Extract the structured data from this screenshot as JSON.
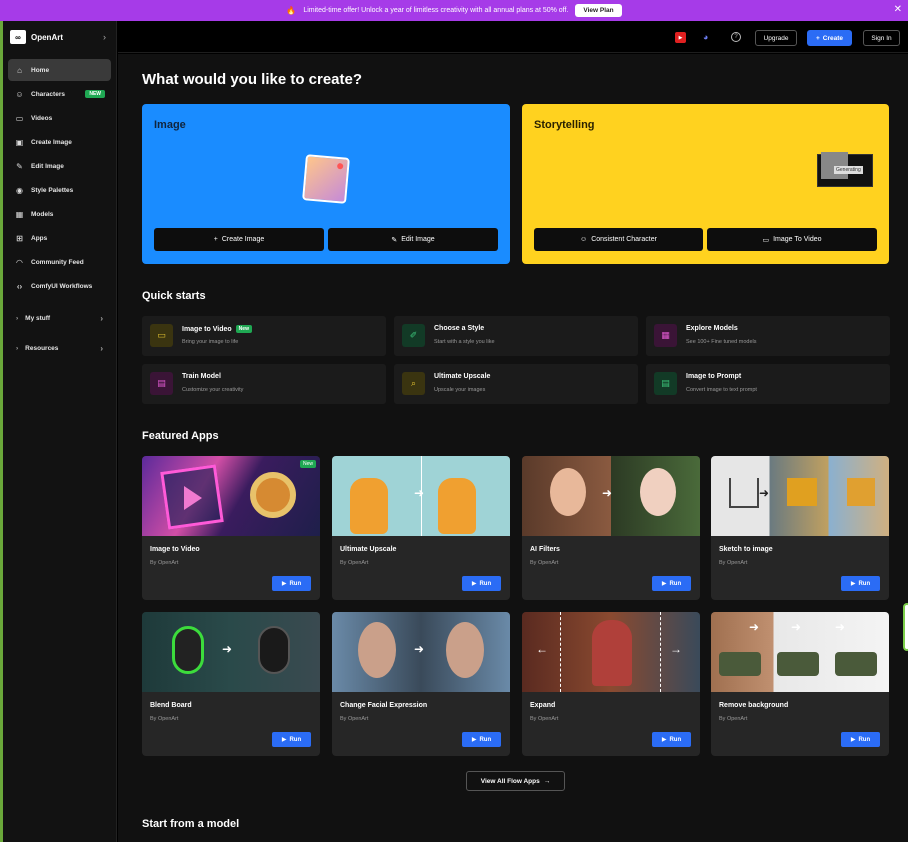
{
  "banner": {
    "text": "Limited-time offer! Unlock a year of limitless creativity with all annual plans at 50% off.",
    "button": "View Plan"
  },
  "sidebar": {
    "brand": "OpenArt",
    "items": [
      {
        "label": "Home",
        "icon": "home-icon"
      },
      {
        "label": "Characters",
        "icon": "users-icon",
        "badge": "NEW"
      },
      {
        "label": "Videos",
        "icon": "video-icon"
      },
      {
        "label": "Create Image",
        "icon": "image-icon"
      },
      {
        "label": "Edit Image",
        "icon": "edit-icon"
      },
      {
        "label": "Style Palettes",
        "icon": "palette-icon"
      },
      {
        "label": "Models",
        "icon": "grid-icon"
      },
      {
        "label": "Apps",
        "icon": "apps-icon"
      },
      {
        "label": "Community Feed",
        "icon": "feed-icon"
      },
      {
        "label": "ComfyUI Workflows",
        "icon": "code-icon"
      }
    ],
    "groups": [
      "My stuff",
      "Resources"
    ]
  },
  "topbar": {
    "upgrade": "Upgrade",
    "create": "Create",
    "signin": "Sign In"
  },
  "main": {
    "heading": "What would you like to create?",
    "image_card": {
      "title": "Image",
      "btn1": "Create Image",
      "btn2": "Edit Image"
    },
    "story_card": {
      "title": "Storytelling",
      "generating": "Generating",
      "btn1": "Consistent Character",
      "btn2": "Image To Video"
    },
    "quick_starts_title": "Quick starts",
    "quick_starts": [
      {
        "title": "Image to Video",
        "sub": "Bring your image to life",
        "badge": "New",
        "color": "#3a3410",
        "icon_color": "#e0c030"
      },
      {
        "title": "Choose a Style",
        "sub": "Start with a style you like",
        "color": "#123a26",
        "icon_color": "#3cc47a"
      },
      {
        "title": "Explore Models",
        "sub": "See 100+ Fine tuned models",
        "color": "#3a1436",
        "icon_color": "#e05ad0"
      },
      {
        "title": "Train Model",
        "sub": "Customize your creativity",
        "color": "#3a1436",
        "icon_color": "#e05ad0"
      },
      {
        "title": "Ultimate Upscale",
        "sub": "Upscale your images",
        "color": "#3a3410",
        "icon_color": "#e0c030"
      },
      {
        "title": "Image to Prompt",
        "sub": "Convert image to text prompt",
        "color": "#123a26",
        "icon_color": "#3cc47a"
      }
    ],
    "featured_title": "Featured Apps",
    "apps": [
      {
        "title": "Image to Video",
        "by": "By OpenArt",
        "run": "Run",
        "badge": "New"
      },
      {
        "title": "Ultimate Upscale",
        "by": "By OpenArt",
        "run": "Run"
      },
      {
        "title": "AI Filters",
        "by": "By OpenArt",
        "run": "Run"
      },
      {
        "title": "Sketch to image",
        "by": "By OpenArt",
        "run": "Run"
      },
      {
        "title": "Blend Board",
        "by": "By OpenArt",
        "run": "Run"
      },
      {
        "title": "Change Facial Expression",
        "by": "By OpenArt",
        "run": "Run"
      },
      {
        "title": "Expand",
        "by": "By OpenArt",
        "run": "Run"
      },
      {
        "title": "Remove background",
        "by": "By OpenArt",
        "run": "Run"
      }
    ],
    "view_all": "View All Flow Apps",
    "model_title": "Start from a model"
  }
}
